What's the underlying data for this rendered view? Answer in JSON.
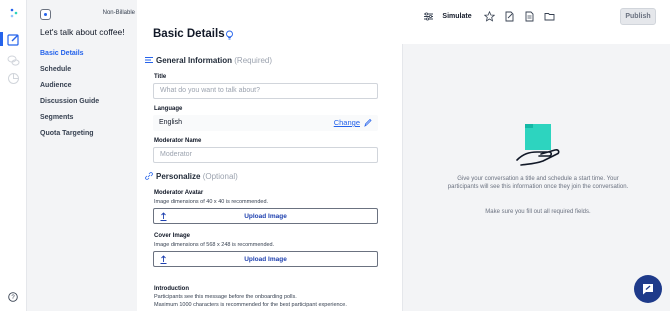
{
  "sidebar": {
    "billable": "Non-Billable",
    "conversation_title": "Let's talk about coffee!",
    "items": [
      {
        "label": "Basic Details",
        "selected": true
      },
      {
        "label": "Schedule"
      },
      {
        "label": "Audience"
      },
      {
        "label": "Discussion Guide"
      },
      {
        "label": "Segments"
      },
      {
        "label": "Quota Targeting"
      }
    ]
  },
  "toolbar": {
    "simulate_label": "Simulate",
    "publish_label": "Publish"
  },
  "page": {
    "title": "Basic Details"
  },
  "general": {
    "heading": "General Information",
    "required": "(Required)",
    "title_label": "Title",
    "title_placeholder": "What do you want to talk about?",
    "language_label": "Language",
    "language_value": "English",
    "change_label": "Change",
    "moderator_label": "Moderator Name",
    "moderator_placeholder": "Moderator"
  },
  "personalize": {
    "heading": "Personalize",
    "optional": "(Optional)",
    "avatar_label": "Moderator Avatar",
    "avatar_hint": "Image dimensions of 40 x 40 is recommended.",
    "upload_label": "Upload Image",
    "cover_label": "Cover Image",
    "cover_hint": "Image dimensions of 568 x 248 is recommended.",
    "cover_upload_label": "Upload Image",
    "intro_label": "Introduction",
    "intro_hint1": "Participants see this message before the onboarding polls.",
    "intro_hint2": "Maximum 1000 characters is recommended for the best participant experience."
  },
  "preview": {
    "text": "Give your conversation a title and schedule a start time. Your participants will see this information once they join the conversation.",
    "text2": "Make sure you fill out all required fields."
  },
  "colors": {
    "accent": "#2563eb",
    "preview_teal": "#2dd4bf",
    "chat": "#1e3a8a"
  }
}
